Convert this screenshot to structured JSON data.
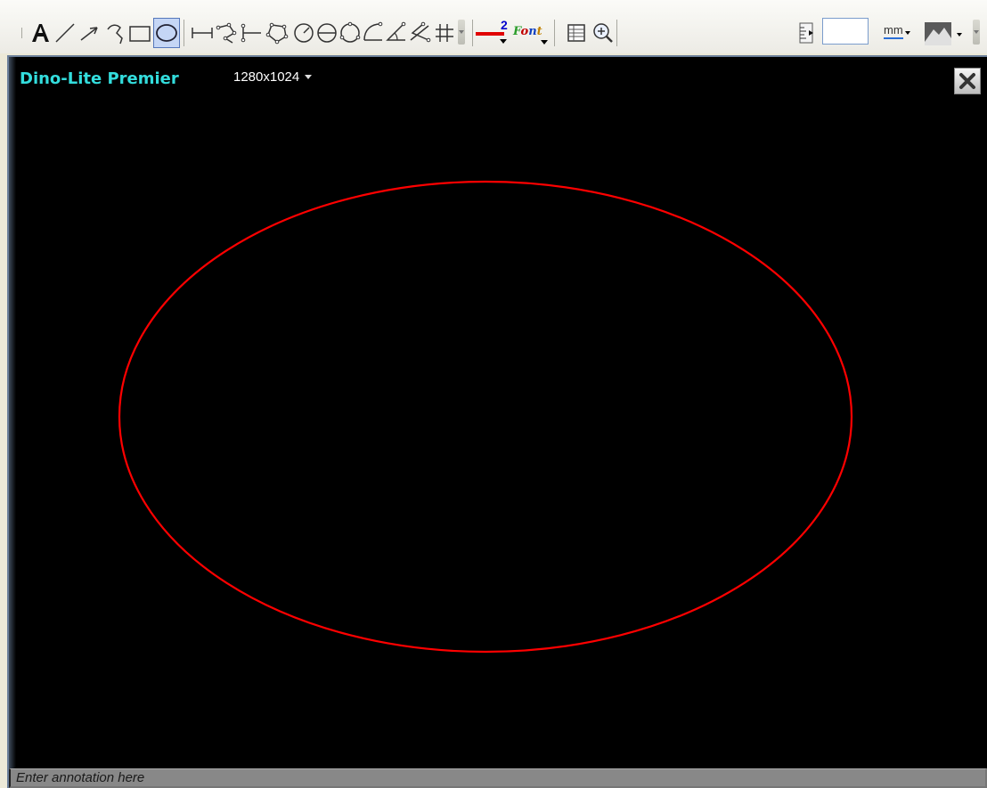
{
  "toolbar": {
    "tools": [
      {
        "name": "text-tool",
        "active": false
      },
      {
        "name": "line-tool",
        "active": false
      },
      {
        "name": "arrow-tool",
        "active": false
      },
      {
        "name": "freehand-tool",
        "active": false
      },
      {
        "name": "rectangle-tool",
        "active": false
      },
      {
        "name": "ellipse-tool",
        "active": true
      },
      {
        "name": "distance-tool",
        "active": false
      },
      {
        "name": "polyline-tool",
        "active": false
      },
      {
        "name": "parallel-line-tool",
        "active": false
      },
      {
        "name": "polygon-tool",
        "active": false
      },
      {
        "name": "circle-center-radius-tool",
        "active": false
      },
      {
        "name": "circle-diameter-tool",
        "active": false
      },
      {
        "name": "circle-three-point-tool",
        "active": false
      },
      {
        "name": "arc-tool",
        "active": false
      },
      {
        "name": "angle-tool",
        "active": false
      },
      {
        "name": "four-point-angle-tool",
        "active": false
      },
      {
        "name": "grid-tool",
        "active": false
      }
    ],
    "line_width": "2",
    "font_label": "Font",
    "zoom_value": "",
    "unit_label": "mm",
    "accent_color": "#e00000"
  },
  "viewer": {
    "device_name": "Dino-Lite Premier",
    "resolution": "1280x1024",
    "annotation_placeholder": "Enter annotation here",
    "shape_color": "#ff0000",
    "title_color": "#33dddd"
  }
}
